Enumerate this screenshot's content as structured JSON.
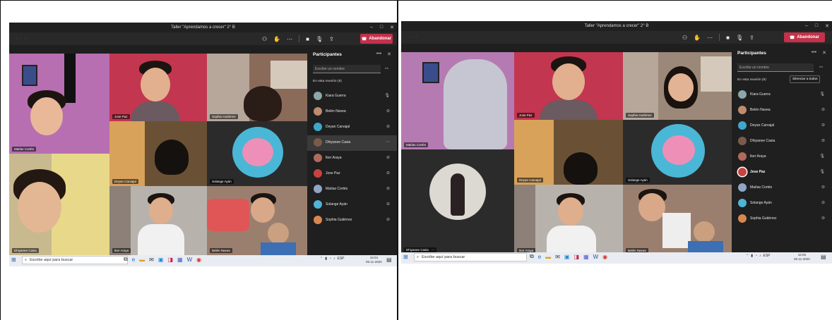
{
  "window_title": "Taller \"Aprendamos a crecer\" 2° B",
  "leave_label": "Abandonar",
  "participants_title": "Participantes",
  "search_placeholder": "Escribe un nombre",
  "mute_all_label": "Silenciar a todos",
  "meeting_count_label": "En esta reunión (9)",
  "panel_more": "•••",
  "close_glyph": "✕",
  "colors": {
    "leave": "#c4314b",
    "panel": "#1f1f1f",
    "toolbar": "#292929",
    "taskbar": "#e9ecf2"
  },
  "icons": [
    "people-icon",
    "raise-hand-icon",
    "more-icon",
    "camera-icon",
    "microphone-icon",
    "share-icon",
    "phone-hangup-icon",
    "search-icon",
    "windows-start-icon"
  ],
  "left": {
    "tiles": [
      {
        "name": "Matías Cortés"
      },
      {
        "name": "Jose Paz"
      },
      {
        "name": "Sophia Gutiérrez"
      },
      {
        "name": "Deyan Carvajal"
      },
      {
        "name": "Solange Ayán"
      },
      {
        "name": "Dhiyanee Casia"
      },
      {
        "name": "Iker Araya"
      },
      {
        "name": "Belén Navea"
      }
    ],
    "participants": [
      {
        "name": "Kiara Guerra",
        "initials": "KG",
        "mic": "on"
      },
      {
        "name": "Belén Navea",
        "mic": "off"
      },
      {
        "name": "Deyan Carvajal",
        "mic": "off"
      },
      {
        "name": "Dhiyanee Casia",
        "mic": "more",
        "highlight": true
      },
      {
        "name": "Iker Araya",
        "mic": "off"
      },
      {
        "name": "Jose Paz",
        "mic": "off"
      },
      {
        "name": "Matías Cortés",
        "initials": "MC",
        "mic": "off"
      },
      {
        "name": "Solange Ayán",
        "mic": "off"
      },
      {
        "name": "Sophia Gutiérrez",
        "mic": "off"
      }
    ],
    "clock": {
      "time": "16:04",
      "date": "06-11-2020"
    }
  },
  "right": {
    "tiles": [
      {
        "name": "Matías Cortés"
      },
      {
        "name": "Jose Paz"
      },
      {
        "name": "Sophia Gutiérrez"
      },
      {
        "name": "Deyan Carvajal"
      },
      {
        "name": "Solange Ayán"
      },
      {
        "name": "Dhiyanee Casia"
      },
      {
        "name": "Iker Araya"
      },
      {
        "name": "Belén Navea"
      }
    ],
    "participants": [
      {
        "name": "Kiara Guerra",
        "initials": "KG",
        "mic": "on"
      },
      {
        "name": "Belén Navea",
        "mic": "off"
      },
      {
        "name": "Deyan Carvajal",
        "mic": "off"
      },
      {
        "name": "Dhiyanee Casia",
        "mic": "off"
      },
      {
        "name": "Iker Araya",
        "mic": "on"
      },
      {
        "name": "Jose Paz",
        "mic": "on",
        "bold": true
      },
      {
        "name": "Matías Cortés",
        "initials": "MC",
        "mic": "off"
      },
      {
        "name": "Solange Ayán",
        "mic": "off"
      },
      {
        "name": "Sophia Gutiérrez",
        "mic": "off"
      }
    ],
    "clock": {
      "time": "16:06",
      "date": "06-11-2020"
    }
  },
  "taskbar": {
    "search_placeholder": "Escribe aquí para buscar",
    "lang": "ESP"
  }
}
